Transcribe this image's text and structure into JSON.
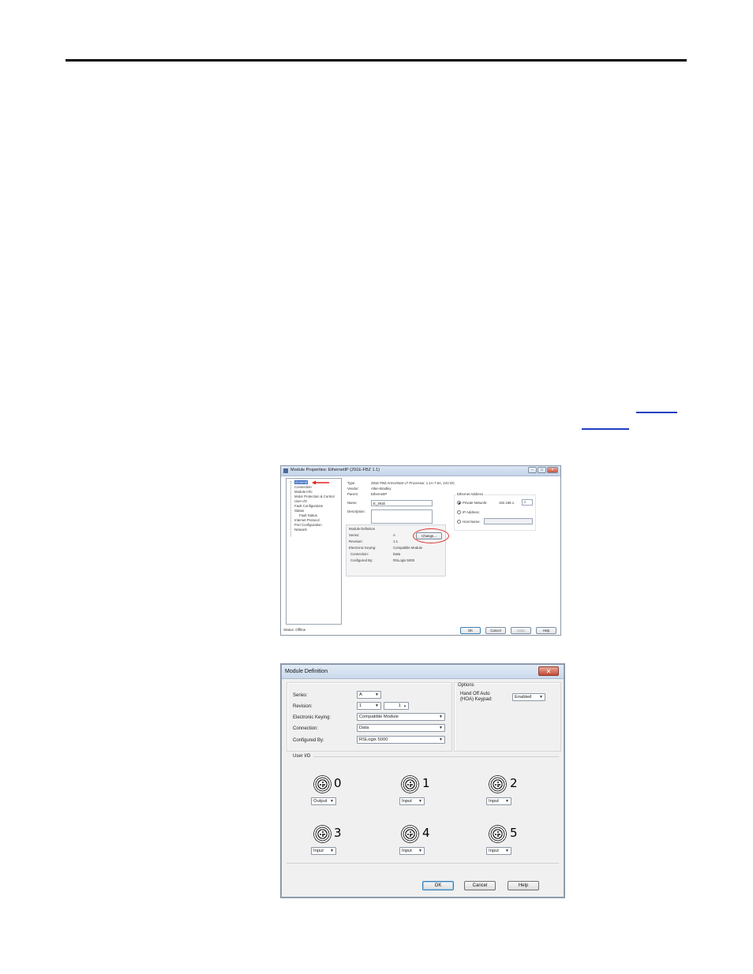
{
  "window1": {
    "title": "Module Properties: EthernetIP (291E-FBZ 1.1)",
    "tree": [
      "General",
      "Connection",
      "Module Info",
      "Motor Protection & Control",
      "User I/O",
      "Fault Configuration",
      "Status",
      "Fault Status",
      "Internet Protocol",
      "Port Configuration",
      "Network"
    ],
    "type_label": "Type:",
    "type_value": "291E-FBZ ArmorStart LT Processor, 1.1A-7.6A, 24V DC",
    "vendor_label": "Vendor:",
    "vendor_value": "Allen-Bradley",
    "parent_label": "Parent:",
    "parent_value": "EthernetIP",
    "name_label": "Name:",
    "name_value": "E_291E",
    "description_label": "Description:",
    "module_def_label": "Module Definition",
    "series_label": "Series:",
    "series_value": "A",
    "revision_label": "Revision:",
    "revision_value": "1.1",
    "keying_label": "Electronic Keying:",
    "keying_value": "Compatible Module",
    "connection_label": "Connection:",
    "connection_value": "Data",
    "configured_label": "Configured By:",
    "configured_value": "RSLogix 5000",
    "change_button": "Change...",
    "ethernet_label": "Ethernet Address",
    "private_network": "Private Network:",
    "private_value": "192.168.1.",
    "private_octet": "2",
    "ip_address": "IP Address:",
    "host_name": "Host Name:",
    "status_text": "Status:  Offline",
    "buttons": {
      "ok": "OK",
      "cancel": "Cancel",
      "apply": "Apply",
      "help": "Help"
    }
  },
  "window2": {
    "title": "Module Definition",
    "series_label": "Series:",
    "series_value": "A",
    "revision_label": "Revision:",
    "revision_major": "1",
    "revision_minor": "1",
    "keying_label": "Electronic Keying:",
    "keying_value": "Compatible Module",
    "connection_label": "Connection:",
    "connection_value": "Data",
    "configured_label": "Configured By:",
    "configured_value": "RSLogix 5000",
    "options_label": "Options",
    "hoa_label_1": "Hand Off Auto",
    "hoa_label_2": "(HOA) Keypad:",
    "hoa_value": "Enabled",
    "user_io_label": "User I/O",
    "io": [
      {
        "num": "0",
        "mode": "Output"
      },
      {
        "num": "1",
        "mode": "Input"
      },
      {
        "num": "2",
        "mode": "Input"
      },
      {
        "num": "3",
        "mode": "Input"
      },
      {
        "num": "4",
        "mode": "Input"
      },
      {
        "num": "5",
        "mode": "Input"
      }
    ],
    "buttons": {
      "ok": "OK",
      "cancel": "Cancel",
      "help": "Help"
    }
  }
}
